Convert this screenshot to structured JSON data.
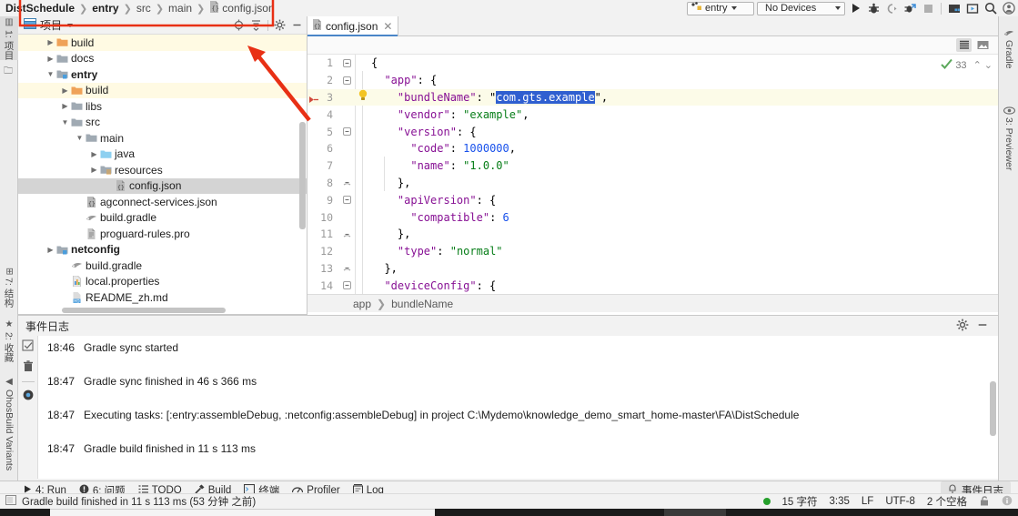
{
  "window": {
    "breadcrumb": [
      {
        "label": "DistSchedule",
        "bold": true,
        "icon": null
      },
      {
        "label": "entry",
        "bold": true,
        "icon": null
      },
      {
        "label": "src",
        "bold": false,
        "icon": null
      },
      {
        "label": "main",
        "bold": false,
        "icon": null
      },
      {
        "label": "config.json",
        "bold": false,
        "icon": "json-file-icon"
      }
    ]
  },
  "run_toolbar": {
    "module_selector": {
      "value": "entry",
      "icon": "module-icon"
    },
    "device_selector": {
      "value": "No Devices"
    },
    "buttons": [
      {
        "name": "run-button",
        "icon": "play-icon"
      },
      {
        "name": "debug-button",
        "icon": "bug-icon"
      },
      {
        "name": "attach-debugger-button",
        "icon": "attach-icon"
      },
      {
        "name": "profile-button",
        "icon": "profiler-icon"
      },
      {
        "name": "stop-button",
        "icon": "stop-icon"
      },
      {
        "name": "device-manager-button",
        "icon": "device-manager-icon"
      },
      {
        "name": "previewer-button",
        "icon": "previewer-icon"
      },
      {
        "name": "search-everywhere-button",
        "icon": "search-icon"
      },
      {
        "name": "account-button",
        "icon": "account-icon"
      }
    ]
  },
  "left_strip": {
    "items": [
      {
        "label": "1: 项目",
        "icon": "project-icon",
        "active": true
      },
      {
        "label": "",
        "icon": "folder-icon",
        "active": false
      },
      {
        "label": "7: 结构",
        "icon": "structure-icon",
        "active": false
      },
      {
        "label": "2: 收藏",
        "icon": "star-icon",
        "active": false
      },
      {
        "label": "OhosBuild Variants",
        "icon": "variants-icon",
        "active": false
      }
    ]
  },
  "right_strip": {
    "items": [
      {
        "label": "Gradle",
        "icon": "gradle-elephant-icon"
      },
      {
        "label": "3: Previewer",
        "icon": "eye-icon"
      }
    ]
  },
  "project_panel": {
    "title": "项目",
    "title_icon": "project-window-icon",
    "header_buttons": [
      {
        "name": "locate-in-tree-button",
        "icon": "target-icon"
      },
      {
        "name": "collapse-all-button",
        "icon": "collapse-all-icon"
      },
      {
        "name": "settings-button",
        "icon": "gear-icon"
      },
      {
        "name": "hide-button",
        "icon": "minimize-icon"
      }
    ],
    "tree": [
      {
        "label": "build",
        "indent": 1,
        "arrow": "collapsed",
        "icon": "folder-orange-icon",
        "bold": false,
        "highlight": true,
        "selected": false
      },
      {
        "label": "docs",
        "indent": 1,
        "arrow": "collapsed",
        "icon": "folder-gray-icon",
        "bold": false,
        "highlight": false,
        "selected": false
      },
      {
        "label": "entry",
        "indent": 1,
        "arrow": "expanded",
        "icon": "module-folder-icon",
        "bold": true,
        "highlight": false,
        "selected": false
      },
      {
        "label": "build",
        "indent": 2,
        "arrow": "collapsed",
        "icon": "folder-orange-icon",
        "bold": false,
        "highlight": true,
        "selected": false
      },
      {
        "label": "libs",
        "indent": 2,
        "arrow": "collapsed",
        "icon": "folder-gray-icon",
        "bold": false,
        "highlight": false,
        "selected": false
      },
      {
        "label": "src",
        "indent": 2,
        "arrow": "expanded",
        "icon": "folder-gray-icon",
        "bold": false,
        "highlight": false,
        "selected": false
      },
      {
        "label": "main",
        "indent": 3,
        "arrow": "expanded",
        "icon": "folder-gray-icon",
        "bold": false,
        "highlight": false,
        "selected": false
      },
      {
        "label": "java",
        "indent": 4,
        "arrow": "collapsed",
        "icon": "folder-source-icon",
        "bold": false,
        "highlight": false,
        "selected": false
      },
      {
        "label": "resources",
        "indent": 4,
        "arrow": "collapsed",
        "icon": "folder-resource-icon",
        "bold": false,
        "highlight": false,
        "selected": false
      },
      {
        "label": "config.json",
        "indent": 5,
        "arrow": "none",
        "icon": "json-file-icon",
        "bold": false,
        "highlight": false,
        "selected": true
      },
      {
        "label": "agconnect-services.json",
        "indent": 2,
        "arrow": "none",
        "icon": "json-file-icon",
        "bold": false,
        "highlight": false,
        "selected": false
      },
      {
        "label": "build.gradle",
        "indent": 2,
        "arrow": "none",
        "icon": "gradle-file-icon",
        "bold": false,
        "highlight": false,
        "selected": false
      },
      {
        "label": "proguard-rules.pro",
        "indent": 2,
        "arrow": "none",
        "icon": "text-file-icon",
        "bold": false,
        "highlight": false,
        "selected": false
      },
      {
        "label": "netconfig",
        "indent": 1,
        "arrow": "collapsed",
        "icon": "module-folder-icon",
        "bold": true,
        "highlight": false,
        "selected": false
      },
      {
        "label": "build.gradle",
        "indent": 1,
        "arrow": "none",
        "icon": "gradle-file-icon",
        "bold": false,
        "highlight": false,
        "selected": false
      },
      {
        "label": "local.properties",
        "indent": 1,
        "arrow": "none",
        "icon": "properties-file-icon",
        "bold": false,
        "highlight": false,
        "selected": false
      },
      {
        "label": "README_zh.md",
        "indent": 1,
        "arrow": "none",
        "icon": "markdown-file-icon",
        "bold": false,
        "highlight": false,
        "selected": false
      }
    ]
  },
  "editor": {
    "tab": {
      "label": "config.json",
      "icon": "json-file-icon",
      "close_icon": "close-icon"
    },
    "toolbar_buttons": [
      {
        "name": "text-view-button",
        "icon": "text-lines-icon",
        "active": true
      },
      {
        "name": "preview-view-button",
        "icon": "image-preview-icon",
        "active": false
      }
    ],
    "inspection_widget": {
      "icon": "inspection-ok-icon",
      "count": "33",
      "up_icon": "chevron-up-icon",
      "down_icon": "chevron-down-icon"
    },
    "breadcrumb": [
      "app",
      "bundleName"
    ],
    "selected_text": "com.gts.example",
    "lines": [
      {
        "num": "1",
        "fold": "expanded",
        "bulb": false,
        "current": false,
        "tokens": [
          {
            "t": "{",
            "c": "p"
          }
        ]
      },
      {
        "num": "2",
        "fold": "expanded",
        "bulb": false,
        "current": false,
        "tokens": [
          {
            "t": "  ",
            "c": "p"
          },
          {
            "t": "\"app\"",
            "c": "k"
          },
          {
            "t": ": {",
            "c": "p"
          }
        ]
      },
      {
        "num": "3",
        "fold": "none",
        "bulb": true,
        "current": true,
        "tokens": [
          {
            "t": "    ",
            "c": "p"
          },
          {
            "t": "\"bundleName\"",
            "c": "k"
          },
          {
            "t": ": \"",
            "c": "p"
          },
          {
            "t": "com.gts.example",
            "c": "sel"
          },
          {
            "t": "\",",
            "c": "p"
          }
        ]
      },
      {
        "num": "4",
        "fold": "none",
        "bulb": false,
        "current": false,
        "tokens": [
          {
            "t": "    ",
            "c": "p"
          },
          {
            "t": "\"vendor\"",
            "c": "k"
          },
          {
            "t": ": ",
            "c": "p"
          },
          {
            "t": "\"example\"",
            "c": "s"
          },
          {
            "t": ",",
            "c": "p"
          }
        ]
      },
      {
        "num": "5",
        "fold": "expanded",
        "bulb": false,
        "current": false,
        "tokens": [
          {
            "t": "    ",
            "c": "p"
          },
          {
            "t": "\"version\"",
            "c": "k"
          },
          {
            "t": ": {",
            "c": "p"
          }
        ]
      },
      {
        "num": "6",
        "fold": "none",
        "bulb": false,
        "current": false,
        "tokens": [
          {
            "t": "      ",
            "c": "p"
          },
          {
            "t": "\"code\"",
            "c": "k"
          },
          {
            "t": ": ",
            "c": "p"
          },
          {
            "t": "1000000",
            "c": "n"
          },
          {
            "t": ",",
            "c": "p"
          }
        ]
      },
      {
        "num": "7",
        "fold": "none",
        "bulb": false,
        "current": false,
        "tokens": [
          {
            "t": "      ",
            "c": "p"
          },
          {
            "t": "\"name\"",
            "c": "k"
          },
          {
            "t": ": ",
            "c": "p"
          },
          {
            "t": "\"1.0.0\"",
            "c": "s"
          }
        ]
      },
      {
        "num": "8",
        "fold": "collapse",
        "bulb": false,
        "current": false,
        "tokens": [
          {
            "t": "    },",
            "c": "p"
          }
        ]
      },
      {
        "num": "9",
        "fold": "expanded",
        "bulb": false,
        "current": false,
        "tokens": [
          {
            "t": "    ",
            "c": "p"
          },
          {
            "t": "\"apiVersion\"",
            "c": "k"
          },
          {
            "t": ": {",
            "c": "p"
          }
        ]
      },
      {
        "num": "10",
        "fold": "none",
        "bulb": false,
        "current": false,
        "tokens": [
          {
            "t": "      ",
            "c": "p"
          },
          {
            "t": "\"compatible\"",
            "c": "k"
          },
          {
            "t": ": ",
            "c": "p"
          },
          {
            "t": "6",
            "c": "n"
          }
        ]
      },
      {
        "num": "11",
        "fold": "collapse",
        "bulb": false,
        "current": false,
        "tokens": [
          {
            "t": "    },",
            "c": "p"
          }
        ]
      },
      {
        "num": "12",
        "fold": "none",
        "bulb": false,
        "current": false,
        "tokens": [
          {
            "t": "    ",
            "c": "p"
          },
          {
            "t": "\"type\"",
            "c": "k"
          },
          {
            "t": ": ",
            "c": "p"
          },
          {
            "t": "\"normal\"",
            "c": "s"
          }
        ]
      },
      {
        "num": "13",
        "fold": "collapse",
        "bulb": false,
        "current": false,
        "tokens": [
          {
            "t": "  },",
            "c": "p"
          }
        ]
      },
      {
        "num": "14",
        "fold": "expanded",
        "bulb": false,
        "current": false,
        "tokens": [
          {
            "t": "  ",
            "c": "p"
          },
          {
            "t": "\"deviceConfig\"",
            "c": "k"
          },
          {
            "t": ": {",
            "c": "p"
          }
        ]
      }
    ]
  },
  "event_log": {
    "title": "事件日志",
    "header_buttons": [
      {
        "name": "settings-button",
        "icon": "gear-icon"
      },
      {
        "name": "hide-button",
        "icon": "minimize-icon"
      }
    ],
    "side_buttons": [
      {
        "name": "mark-read-button",
        "icon": "checkbox-icon"
      },
      {
        "name": "clear-all-button",
        "icon": "trash-icon"
      },
      {
        "name": "filter-button",
        "icon": "settings-ring-icon"
      }
    ],
    "entries": [
      {
        "time": "18:46",
        "message": "Gradle sync started"
      },
      {
        "time": "18:47",
        "message": "Gradle sync finished in 46 s 366 ms"
      },
      {
        "time": "18:47",
        "message": "Executing tasks: [:entry:assembleDebug, :netconfig:assembleDebug] in project C:\\Mydemo\\knowledge_demo_smart_home-master\\FA\\DistSchedule"
      },
      {
        "time": "18:47",
        "message": "Gradle build finished in 11 s 113 ms"
      }
    ]
  },
  "bottom_bar": {
    "tools": [
      {
        "label": "4: Run",
        "icon": "play-icon",
        "mnemonic": "4"
      },
      {
        "label": "6: 问题",
        "icon": "problems-icon",
        "mnemonic": "6"
      },
      {
        "label": "TODO",
        "icon": "todo-icon",
        "mnemonic": ""
      },
      {
        "label": "Build",
        "icon": "hammer-icon",
        "mnemonic": ""
      },
      {
        "label": "终端",
        "icon": "terminal-icon",
        "mnemonic": ""
      },
      {
        "label": "Profiler",
        "icon": "profiler-icon",
        "mnemonic": ""
      },
      {
        "label": "Log",
        "icon": "log-icon",
        "mnemonic": ""
      }
    ],
    "event_log_chip": {
      "label": "事件日志",
      "icon": "bell-icon"
    }
  },
  "status_bar": {
    "icon": "status-window-icon",
    "message": "Gradle build finished in 11 s 113 ms (53 分钟 之前)",
    "right": {
      "chars": "15 字符",
      "caret": "3:35",
      "line_separator": "LF",
      "encoding": "UTF-8",
      "indent": "2 个空格",
      "lock_icon": "unlocked-icon",
      "inspection_icon": "inspection-icon",
      "status_dot_color": "#26a02c"
    }
  },
  "annotations": {
    "rect_color": "#e83015",
    "arrow_color": "#e83015"
  }
}
